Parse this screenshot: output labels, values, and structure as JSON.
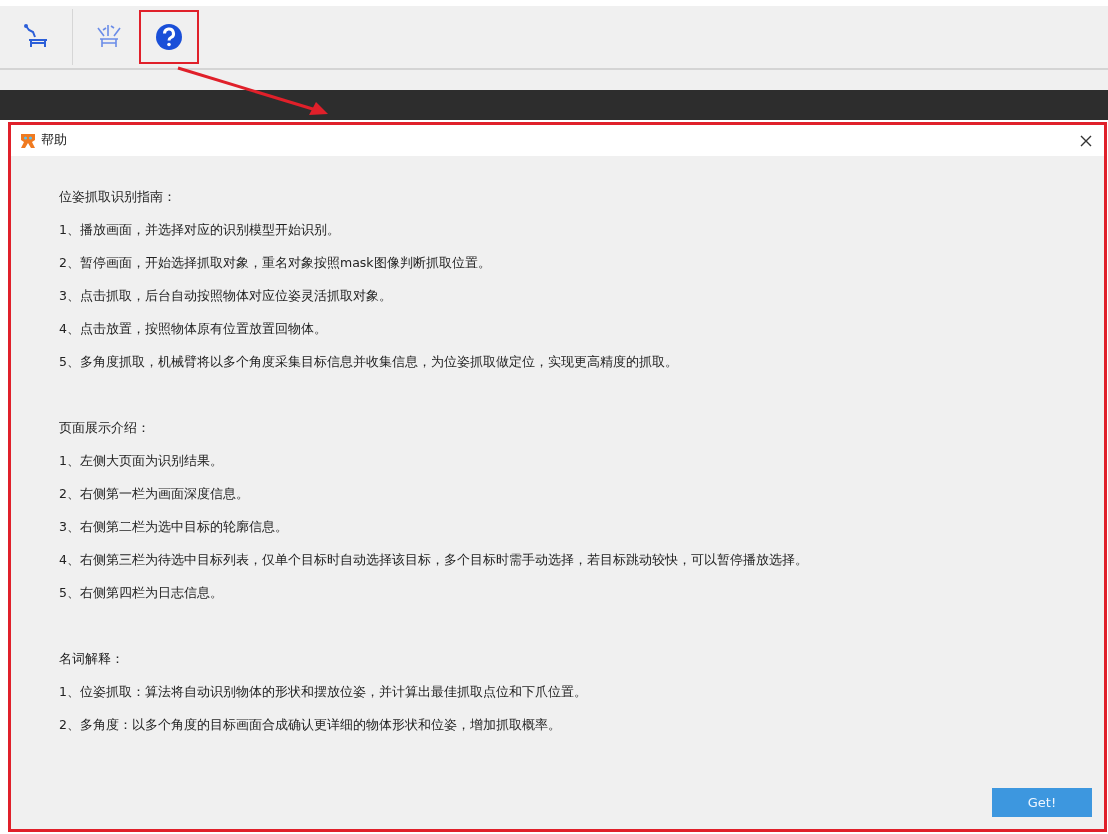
{
  "toolbar": {
    "buttons": [
      {
        "kind": "robot-arm",
        "highlighted": false
      },
      {
        "kind": "multi-arm",
        "highlighted": false
      },
      {
        "kind": "help",
        "highlighted": true
      }
    ]
  },
  "dialog": {
    "title": "帮助",
    "sections": [
      {
        "heading": "位姿抓取识别指南：",
        "items": [
          "1、播放画面，并选择对应的识别模型开始识别。",
          "2、暂停画面，开始选择抓取对象，重名对象按照mask图像判断抓取位置。",
          "3、点击抓取，后台自动按照物体对应位姿灵活抓取对象。",
          "4、点击放置，按照物体原有位置放置回物体。",
          "5、多角度抓取，机械臂将以多个角度采集目标信息并收集信息，为位姿抓取做定位，实现更高精度的抓取。"
        ]
      },
      {
        "heading": "页面展示介绍：",
        "items": [
          "1、左侧大页面为识别结果。",
          "2、右侧第一栏为画面深度信息。",
          "3、右侧第二栏为选中目标的轮廓信息。",
          "4、右侧第三栏为待选中目标列表，仅单个目标时自动选择该目标，多个目标时需手动选择，若目标跳动较快，可以暂停播放选择。",
          "5、右侧第四栏为日志信息。"
        ]
      },
      {
        "heading": "名词解释：",
        "items": [
          "1、位姿抓取：算法将自动识别物体的形状和摆放位姿，并计算出最佳抓取点位和下爪位置。",
          "2、多角度：以多个角度的目标画面合成确认更详细的物体形状和位姿，增加抓取概率。"
        ]
      }
    ],
    "button": "Get!"
  }
}
